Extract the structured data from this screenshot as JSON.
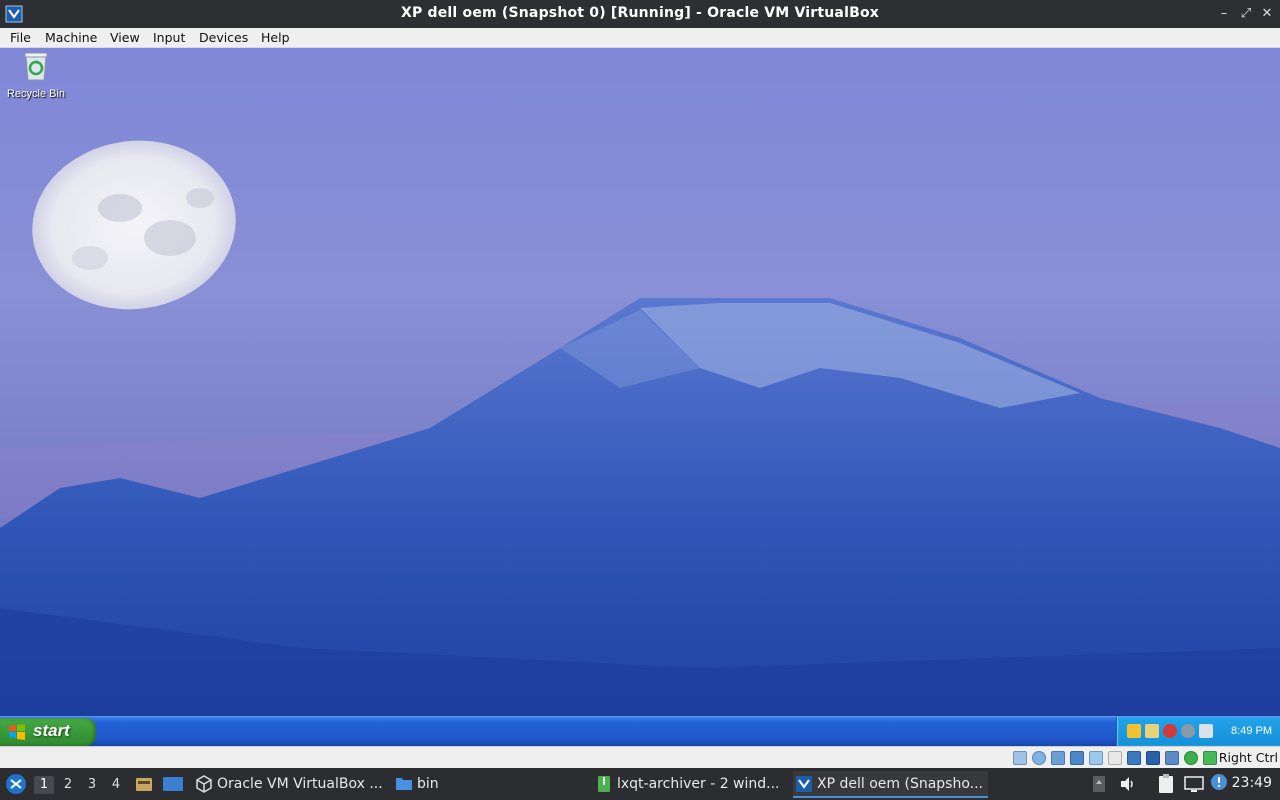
{
  "window": {
    "title": "XP dell oem (Snapshot 0) [Running] - Oracle VM VirtualBox",
    "logo_icon": "virtualbox-icon",
    "controls": [
      "minimize",
      "maximize",
      "close"
    ]
  },
  "menubar": {
    "items": [
      "File",
      "Machine",
      "View",
      "Input",
      "Devices",
      "Help"
    ]
  },
  "guest": {
    "desktop_icons": [
      {
        "label": "Recycle Bin",
        "icon": "recycle-bin-icon"
      }
    ],
    "taskbar": {
      "start_label": "start",
      "tray_icons": [
        "network-warning-icon",
        "security-alert-icon",
        "shield-icon",
        "antivirus-icon",
        "safely-remove-icon"
      ],
      "clock": "8:49 PM"
    }
  },
  "vbox_status": {
    "icons": [
      "hard-disk-icon",
      "optical-drive-icon",
      "audio-icon",
      "network-icon",
      "usb-icon",
      "shared-folder-icon",
      "display-icon",
      "recording-icon",
      "cpu-icon",
      "mouse-integration-icon",
      "keyboard-icon"
    ],
    "host_key": "Right Ctrl"
  },
  "lxqt": {
    "workspaces": [
      "1",
      "2",
      "3",
      "4"
    ],
    "active_workspace": "1",
    "quicklaunch": [
      "file-manager-icon",
      "show-desktop-icon"
    ],
    "tasks": [
      {
        "label": "Oracle VM VirtualBox ...",
        "icon": "virtualbox-icon"
      },
      {
        "label": "bin",
        "icon": "folder-icon"
      },
      {
        "label": "lxqt-archiver - 2 wind...",
        "icon": "archiver-icon"
      },
      {
        "label": "XP dell oem (Snapsho...",
        "icon": "virtualbox-vm-icon"
      }
    ],
    "tray_icons": [
      "drive-icon",
      "volume-icon",
      "clipboard-icon",
      "screen-icon",
      "notification-icon"
    ],
    "clock": "23:49"
  },
  "colors": {
    "xp_taskbar": "#2361d8",
    "xp_start": "#3c9c3c",
    "xp_tray": "#1590d8",
    "panel_bg": "#2b2d30",
    "accent": "#4c8fd6"
  }
}
